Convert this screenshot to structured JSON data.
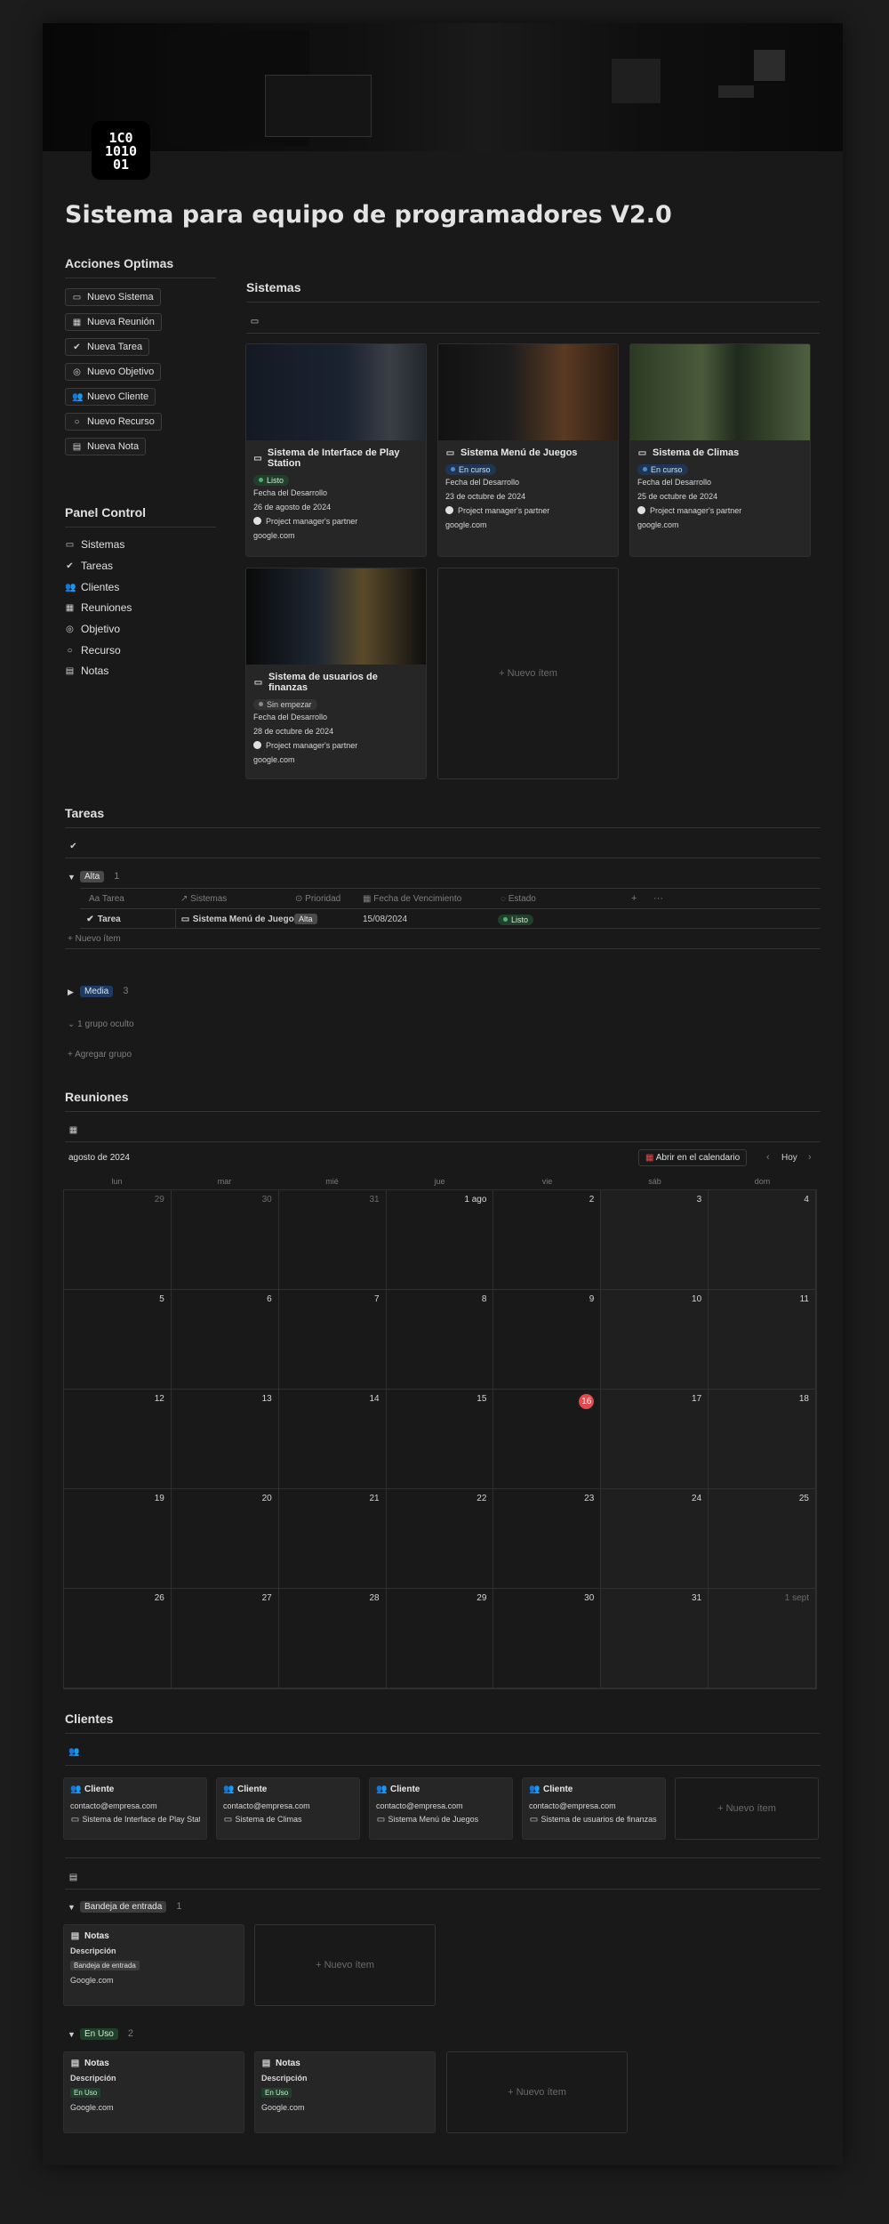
{
  "logo": {
    "lines": [
      "1C0",
      "1010",
      "01"
    ]
  },
  "page_title": "Sistema para equipo de programadores V2.0",
  "acciones": {
    "heading": "Acciones Optimas",
    "buttons": [
      "Nuevo Sistema",
      "Nueva Reunión",
      "Nueva Tarea",
      "Nuevo Objetivo",
      "Nuevo Cliente",
      "Nuevo Recurso",
      "Nueva Nota"
    ]
  },
  "panel": {
    "heading": "Panel Control",
    "items": [
      "Sistemas",
      "Tareas",
      "Clientes",
      "Reuniones",
      "Objetivo",
      "Recurso",
      "Notas"
    ]
  },
  "sistemas": {
    "heading": "Sistemas",
    "cards": [
      {
        "title": "Sistema de Interface de Play Station",
        "status": "Listo",
        "field": "Fecha del Desarrollo",
        "date": "26 de agosto de 2024",
        "owner": "Project manager's partner",
        "link": "google.com",
        "color": "green"
      },
      {
        "title": "Sistema Menú de Juegos",
        "status": "En curso",
        "field": "Fecha del Desarrollo",
        "date": "23 de octubre de 2024",
        "owner": "Project manager's partner",
        "link": "google.com",
        "color": "blue"
      },
      {
        "title": "Sistema  de Climas",
        "status": "En curso",
        "field": "Fecha del Desarrollo",
        "date": "25 de octubre de 2024",
        "owner": "Project manager's partner",
        "link": "google.com",
        "color": "blue"
      },
      {
        "title": "Sistema de usuarios de finanzas",
        "status": "Sin empezar",
        "field": "Fecha del Desarrollo",
        "date": "28 de octubre de 2024",
        "owner": "Project manager's partner",
        "link": "google.com",
        "color": "gray"
      }
    ],
    "new_item": "Nuevo ítem"
  },
  "tareas": {
    "heading": "Tareas",
    "group_alta": "Alta",
    "group_alta_count": "1",
    "columns": [
      "Tarea",
      "Sistemas",
      "Prioridad",
      "Fecha de Vencimiento",
      "Estado"
    ],
    "row": {
      "name": "Tarea",
      "system": "Sistema Menú de Juegos",
      "priority": "Alta",
      "date": "15/08/2024",
      "status": "Listo"
    },
    "new_item": "Nuevo ítem",
    "group_media": "Media",
    "group_media_count": "3",
    "hidden": "1 grupo oculto",
    "add_group": "Agregar grupo"
  },
  "reuniones": {
    "heading": "Reuniones",
    "month": "agosto de 2024",
    "open_cal": "Abrir en el calendario",
    "today": "Hoy",
    "weekdays": [
      "lun",
      "mar",
      "mié",
      "jue",
      "vie",
      "sáb",
      "dom"
    ],
    "days": [
      "29",
      "30",
      "31",
      "1 ago",
      "2",
      "3",
      "4",
      "5",
      "6",
      "7",
      "8",
      "9",
      "10",
      "11",
      "12",
      "13",
      "14",
      "15",
      "16",
      "17",
      "18",
      "19",
      "20",
      "21",
      "22",
      "23",
      "24",
      "25",
      "26",
      "27",
      "28",
      "29",
      "30",
      "31",
      "1 sept"
    ]
  },
  "clientes": {
    "heading": "Clientes",
    "cards": [
      {
        "title": "Cliente",
        "email": "contacto@empresa.com",
        "system": "Sistema de Interface de Play Station"
      },
      {
        "title": "Cliente",
        "email": "contacto@empresa.com",
        "system": "Sistema de Climas"
      },
      {
        "title": "Cliente",
        "email": "contacto@empresa.com",
        "system": "Sistema Menú de Juegos"
      },
      {
        "title": "Cliente",
        "email": "contacto@empresa.com",
        "system": "Sistema de usuarios de finanzas"
      }
    ],
    "new_item": "Nuevo ítem"
  },
  "notas": {
    "group1": "Bandeja de entrada",
    "group1_count": "1",
    "group2": "En Uso",
    "group2_count": "2",
    "card_title": "Notas",
    "desc": "Descripción",
    "link": "Google.com",
    "new_item": "Nuevo ítem"
  }
}
